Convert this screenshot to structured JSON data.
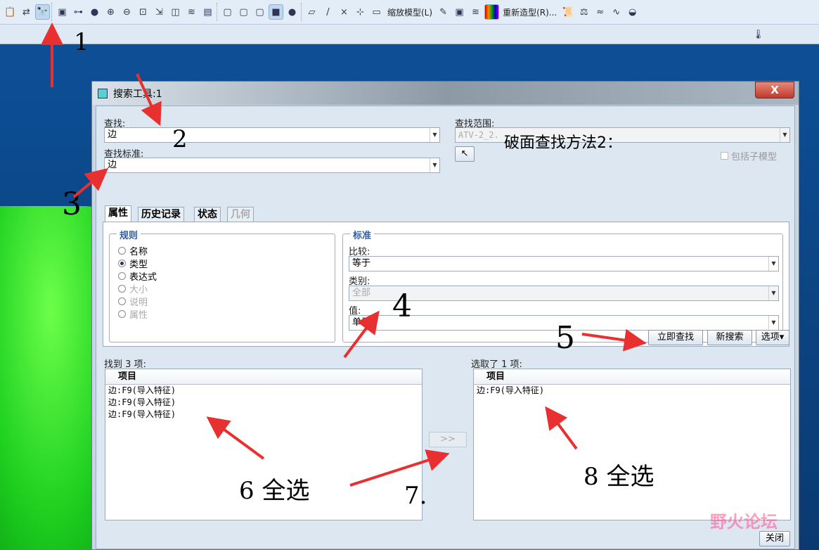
{
  "toolbar": {
    "zoom_model_label": "缩放模型(L)",
    "restyle_label": "重新造型(R)...",
    "icons": [
      "paste-icon",
      "regenerate-icon",
      "search-binoculars-icon",
      "sketch-view-icon",
      "node-icon",
      "shading-icon",
      "zoom-in-icon",
      "zoom-out-icon",
      "refit-icon",
      "orient-icon",
      "annotation-icon",
      "layers-icon",
      "view-manager-icon",
      "wireframe-icon",
      "hidden-line-icon",
      "no-hidden-icon",
      "shaded-icon",
      "spin-center-icon",
      "plane-display-icon",
      "axis-display-icon",
      "point-display-icon",
      "csys-display-icon",
      "annotation-display-icon"
    ]
  },
  "dialog": {
    "title": "搜索工具:1",
    "close_label": "X",
    "look_for_label": "查找:",
    "look_for_value": "边",
    "criteria_label": "查找标准:",
    "criteria_value": "边",
    "scope_label": "查找范围:",
    "scope_value": "ATV-2_2.",
    "include_submodels_label": "包括子模型",
    "tabs": [
      "属性",
      "历史记录",
      "状态",
      "几何"
    ],
    "rules_title": "规则",
    "rules": [
      {
        "label": "名称",
        "selected": false,
        "enabled": true
      },
      {
        "label": "类型",
        "selected": true,
        "enabled": true
      },
      {
        "label": "表达式",
        "selected": false,
        "enabled": true
      },
      {
        "label": "大小",
        "selected": false,
        "enabled": false
      },
      {
        "label": "说明",
        "selected": false,
        "enabled": false
      },
      {
        "label": "属性",
        "selected": false,
        "enabled": false
      }
    ],
    "criteria_title": "标准",
    "compare_label": "比较:",
    "compare_value": "等于",
    "category_label": "类别:",
    "category_value": "全部",
    "value_label": "值:",
    "value_value": "单侧",
    "find_now": "立即查找",
    "new_search": "新搜索",
    "options": "选项",
    "found_label": "找到 3 项:",
    "found_header": "项目",
    "found_items": [
      "边:F9(导入特征)",
      "边:F9(导入特征)",
      "边:F9(导入特征)"
    ],
    "move_label": ">>",
    "selected_label": "选取了 1 项:",
    "selected_header": "项目",
    "selected_items": [
      "边:F9(导入特征)"
    ],
    "close_button": "关闭"
  },
  "annotation": {
    "heading": "破面查找方法2：",
    "marks": [
      "1",
      "2",
      "3",
      "4",
      "5",
      "6 全选",
      "7.",
      "8 全选"
    ]
  },
  "watermark": "野火论坛",
  "colors": {
    "accent_arrow": "#e83030",
    "viewport": "#0b4a8c",
    "model": "#22d020"
  }
}
